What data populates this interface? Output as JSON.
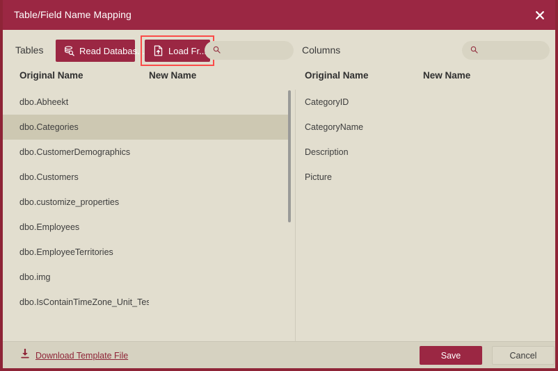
{
  "window": {
    "title": "Table/Field Name Mapping",
    "close_icon": "close-x-icon",
    "accent_color": "#9b2743",
    "background_color": "#e2decf",
    "highlight_color": "#fb4b48",
    "selected_row_color": "#cdc8b2"
  },
  "tables_panel": {
    "label": "Tables",
    "read_database_button": {
      "label": "Read Databas...",
      "icon": "database-search-icon"
    },
    "load_from_button": {
      "label": "Load Fr...",
      "icon": "file-upload-icon",
      "focused": true
    },
    "search": {
      "value": "",
      "placeholder": "",
      "icon": "search-icon"
    },
    "columns": {
      "original_name": "Original Name",
      "new_name": "New Name"
    },
    "rows": [
      {
        "original": "dbo.Abheekt",
        "new": "",
        "selected": false
      },
      {
        "original": "dbo.Categories",
        "new": "",
        "selected": true
      },
      {
        "original": "dbo.CustomerDemographics",
        "new": "",
        "selected": false
      },
      {
        "original": "dbo.Customers",
        "new": "",
        "selected": false
      },
      {
        "original": "dbo.customize_properties",
        "new": "",
        "selected": false
      },
      {
        "original": "dbo.Employees",
        "new": "",
        "selected": false
      },
      {
        "original": "dbo.EmployeeTerritories",
        "new": "",
        "selected": false
      },
      {
        "original": "dbo.img",
        "new": "",
        "selected": false
      },
      {
        "original": "dbo.IsContainTimeZone_Unit_Test",
        "new": "",
        "selected": false
      }
    ]
  },
  "columns_panel": {
    "label": "Columns",
    "search": {
      "value": "",
      "placeholder": "",
      "icon": "search-icon"
    },
    "columns": {
      "original_name": "Original Name",
      "new_name": "New Name"
    },
    "rows": [
      {
        "original": "CategoryID",
        "new": "",
        "selected": false
      },
      {
        "original": "CategoryName",
        "new": "",
        "selected": false
      },
      {
        "original": "Description",
        "new": "",
        "selected": false
      },
      {
        "original": "Picture",
        "new": "",
        "selected": false
      }
    ]
  },
  "footer": {
    "download_template_label": "Download Template File",
    "download_icon": "download-arrow-icon",
    "save_label": "Save",
    "cancel_label": "Cancel"
  }
}
